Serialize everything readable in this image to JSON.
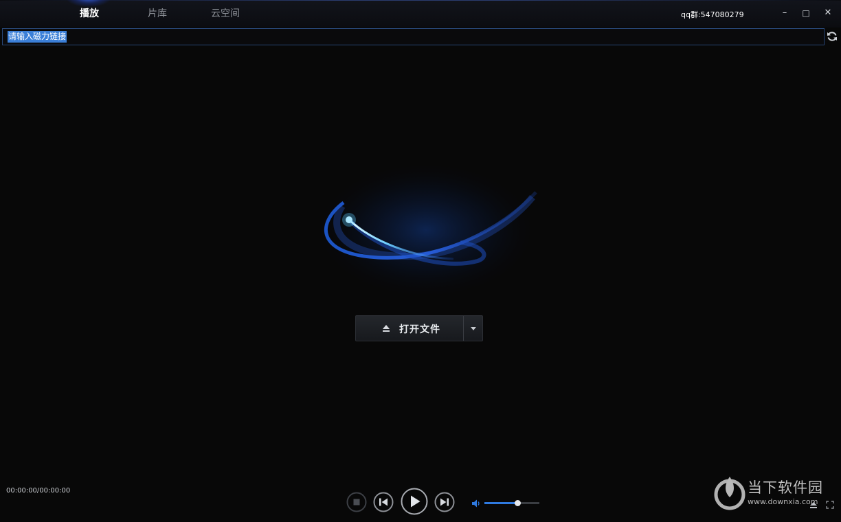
{
  "tabs": [
    {
      "label": "播放",
      "active": true
    },
    {
      "label": "片库",
      "active": false
    },
    {
      "label": "云空间",
      "active": false
    }
  ],
  "qq_group": "qq群:547080279",
  "window_controls": {
    "minimize": "–",
    "maximize": "□",
    "close": "✕"
  },
  "magnet_input": {
    "value": "请输入磁力链接",
    "selected": true
  },
  "open_file": {
    "label": "打开文件"
  },
  "playback": {
    "time": "00:00:00/00:00:00",
    "volume_level": 0.6
  },
  "watermark": {
    "brand": "当下软件园",
    "url": "www.downxia.com"
  },
  "colors": {
    "accent": "#2f7ae0",
    "background": "#080808",
    "selection": "#3b7fd8"
  },
  "icons": {
    "refresh": "refresh-icon",
    "eject": "eject-icon",
    "dropdown": "chevron-down-icon",
    "stop": "stop-icon",
    "previous": "skip-previous-icon",
    "play": "play-icon",
    "next": "skip-next-icon",
    "volume": "volume-icon"
  }
}
